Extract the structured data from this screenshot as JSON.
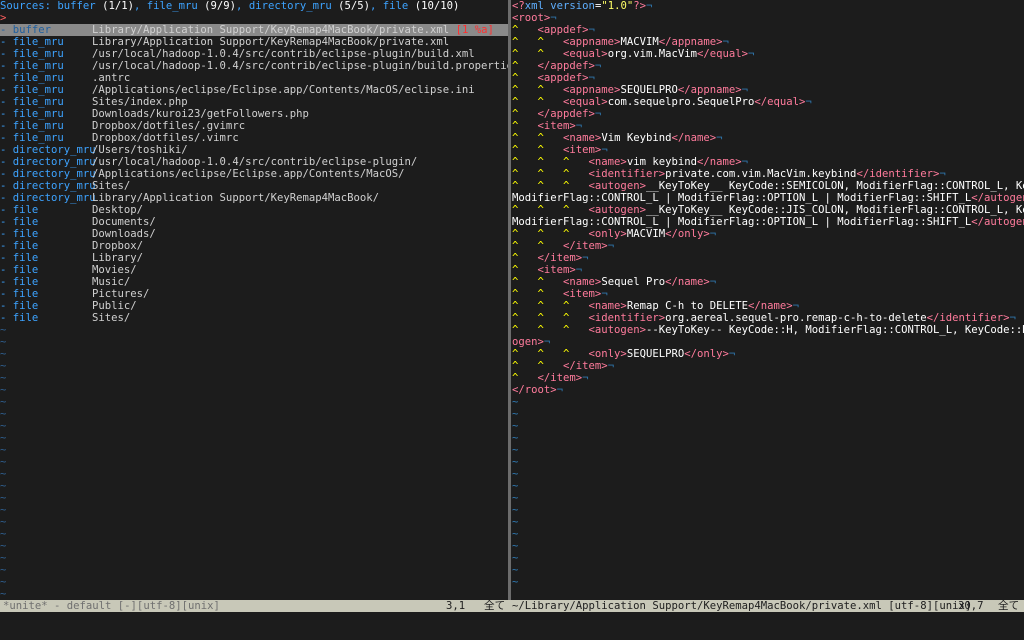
{
  "left": {
    "header": {
      "label": "Sources: ",
      "segments": [
        {
          "name": "buffer",
          "count": "(1/1)",
          "sep": ", "
        },
        {
          "name": "file_mru",
          "count": "(9/9)",
          "sep": ", "
        },
        {
          "name": "directory_mru",
          "count": "(5/5)",
          "sep": ", "
        },
        {
          "name": "file",
          "count": "(10/10)",
          "sep": ""
        }
      ]
    },
    "prompt": ">",
    "candidates": [
      {
        "kind": "- buffer",
        "path": "Library/Application Support/KeyRemap4MacBook/private.xml",
        "info": "[1 %a]",
        "selected": true
      },
      {
        "kind": "- file_mru",
        "path": "Library/Application Support/KeyRemap4MacBook/private.xml"
      },
      {
        "kind": "- file_mru",
        "path": "/usr/local/hadoop-1.0.4/src/contrib/eclipse-plugin/build.xml"
      },
      {
        "kind": "- file_mru",
        "path": "/usr/local/hadoop-1.0.4/src/contrib/eclipse-plugin/build.properties"
      },
      {
        "kind": "- file_mru",
        "path": ".antrc"
      },
      {
        "kind": "- file_mru",
        "path": "/Applications/eclipse/Eclipse.app/Contents/MacOS/eclipse.ini"
      },
      {
        "kind": "- file_mru",
        "path": "Sites/index.php"
      },
      {
        "kind": "- file_mru",
        "path": "Downloads/kuroi23/getFollowers.php"
      },
      {
        "kind": "- file_mru",
        "path": "Dropbox/dotfiles/.gvimrc"
      },
      {
        "kind": "- file_mru",
        "path": "Dropbox/dotfiles/.vimrc"
      },
      {
        "kind": "- directory_mru",
        "path": "/Users/toshiki/"
      },
      {
        "kind": "- directory_mru",
        "path": "/usr/local/hadoop-1.0.4/src/contrib/eclipse-plugin/"
      },
      {
        "kind": "- directory_mru",
        "path": "/Applications/eclipse/Eclipse.app/Contents/MacOS/"
      },
      {
        "kind": "- directory_mru",
        "path": "Sites/"
      },
      {
        "kind": "- directory_mru",
        "path": "Library/Application Support/KeyRemap4MacBook/"
      },
      {
        "kind": "- file",
        "path": "Desktop/"
      },
      {
        "kind": "- file",
        "path": "Documents/"
      },
      {
        "kind": "- file",
        "path": "Downloads/"
      },
      {
        "kind": "- file",
        "path": "Dropbox/"
      },
      {
        "kind": "- file",
        "path": "Library/"
      },
      {
        "kind": "- file",
        "path": "Movies/"
      },
      {
        "kind": "- file",
        "path": "Music/"
      },
      {
        "kind": "- file",
        "path": "Pictures/"
      },
      {
        "kind": "- file",
        "path": "Public/"
      },
      {
        "kind": "- file",
        "path": "Sites/"
      }
    ],
    "tilde": "~",
    "tilde_count": 23
  },
  "right": {
    "lines": [
      [
        {
          "c": "pi",
          "t": "<?"
        },
        {
          "c": "attr",
          "t": "xml version"
        },
        {
          "c": "tagtxt",
          "t": "="
        },
        {
          "c": "str",
          "t": "\"1.0\""
        },
        {
          "c": "pi",
          "t": "?>"
        },
        {
          "c": "tilde",
          "t": "¬"
        }
      ],
      [
        {
          "c": "tag",
          "t": "<root>"
        },
        {
          "c": "tilde",
          "t": "¬"
        }
      ],
      [
        {
          "c": "caret",
          "t": "^   "
        },
        {
          "c": "tag",
          "t": "<appdef>"
        },
        {
          "c": "tilde",
          "t": "¬"
        }
      ],
      [
        {
          "c": "caret",
          "t": "^   ^   "
        },
        {
          "c": "tag",
          "t": "<appname>"
        },
        {
          "c": "tagtxt",
          "t": "MACVIM"
        },
        {
          "c": "tag",
          "t": "</appname>"
        },
        {
          "c": "tilde",
          "t": "¬"
        }
      ],
      [
        {
          "c": "caret",
          "t": "^   ^   "
        },
        {
          "c": "tag",
          "t": "<equal>"
        },
        {
          "c": "tagtxt",
          "t": "org.vim.MacVim"
        },
        {
          "c": "tag",
          "t": "</equal>"
        },
        {
          "c": "tilde",
          "t": "¬"
        }
      ],
      [
        {
          "c": "caret",
          "t": "^   "
        },
        {
          "c": "tag",
          "t": "</appdef>"
        },
        {
          "c": "tilde",
          "t": "¬"
        }
      ],
      [
        {
          "c": "caret",
          "t": "^   "
        },
        {
          "c": "tag",
          "t": "<appdef>"
        },
        {
          "c": "tilde",
          "t": "¬"
        }
      ],
      [
        {
          "c": "caret",
          "t": "^   ^   "
        },
        {
          "c": "tag",
          "t": "<appname>"
        },
        {
          "c": "tagtxt",
          "t": "SEQUELPRO"
        },
        {
          "c": "tag",
          "t": "</appname>"
        },
        {
          "c": "tilde",
          "t": "¬"
        }
      ],
      [
        {
          "c": "caret",
          "t": "^   ^   "
        },
        {
          "c": "tag",
          "t": "<equal>"
        },
        {
          "c": "tagtxt",
          "t": "com.sequelpro.SequelPro"
        },
        {
          "c": "tag",
          "t": "</equal>"
        },
        {
          "c": "tilde",
          "t": "¬"
        }
      ],
      [
        {
          "c": "caret",
          "t": "^   "
        },
        {
          "c": "tag",
          "t": "</appdef>"
        },
        {
          "c": "tilde",
          "t": "¬"
        }
      ],
      [
        {
          "c": "caret",
          "t": "^   "
        },
        {
          "c": "tag",
          "t": "<item>"
        },
        {
          "c": "tilde",
          "t": "¬"
        }
      ],
      [
        {
          "c": "caret",
          "t": "^   ^   "
        },
        {
          "c": "tag",
          "t": "<name>"
        },
        {
          "c": "tagtxt",
          "t": "Vim Keybind"
        },
        {
          "c": "tag",
          "t": "</name>"
        },
        {
          "c": "tilde",
          "t": "¬"
        }
      ],
      [
        {
          "c": "caret",
          "t": "^   ^   "
        },
        {
          "c": "tag",
          "t": "<item>"
        },
        {
          "c": "tilde",
          "t": "¬"
        }
      ],
      [
        {
          "c": "caret",
          "t": "^   ^   ^   "
        },
        {
          "c": "tag",
          "t": "<name>"
        },
        {
          "c": "tagtxt",
          "t": "vim keybind"
        },
        {
          "c": "tag",
          "t": "</name>"
        },
        {
          "c": "tilde",
          "t": "¬"
        }
      ],
      [
        {
          "c": "caret",
          "t": "^   ^   ^   "
        },
        {
          "c": "tag",
          "t": "<identifier>"
        },
        {
          "c": "tagtxt",
          "t": "private.com.vim.MacVim.keybind"
        },
        {
          "c": "tag",
          "t": "</identifier>"
        },
        {
          "c": "tilde",
          "t": "¬"
        }
      ],
      [
        {
          "c": "caret",
          "t": "^   ^   ^   "
        },
        {
          "c": "tag",
          "t": "<autogen>"
        },
        {
          "c": "tagtxt",
          "t": "__KeyToKey__ KeyCode::SEMICOLON, ModifierFlag::CONTROL_L, KeyCode::A,"
        }
      ],
      [
        {
          "c": "tagtxt",
          "t": "ModifierFlag::CONTROL_L | ModifierFlag::OPTION_L | ModifierFlag::SHIFT_L"
        },
        {
          "c": "tag",
          "t": "</autogen>"
        },
        {
          "c": "tilde",
          "t": "¬"
        }
      ],
      [
        {
          "c": "caret",
          "t": "^   ^   ^   "
        },
        {
          "c": "tag",
          "t": "<autogen>"
        },
        {
          "c": "tagtxt",
          "t": "__KeyToKey__ KeyCode::JIS_COLON, ModifierFlag::CONTROL_L, KeyCode::B,"
        }
      ],
      [
        {
          "c": "tagtxt",
          "t": "ModifierFlag::CONTROL_L | ModifierFlag::OPTION_L | ModifierFlag::SHIFT_L"
        },
        {
          "c": "tag",
          "t": "</autogen>"
        },
        {
          "c": "tilde",
          "t": "¬"
        }
      ],
      [
        {
          "c": "caret",
          "t": "^   ^   ^   "
        },
        {
          "c": "tag",
          "t": "<only>"
        },
        {
          "c": "tagtxt",
          "t": "MACVIM"
        },
        {
          "c": "tag",
          "t": "</only>"
        },
        {
          "c": "tilde",
          "t": "¬"
        }
      ],
      [
        {
          "c": "caret",
          "t": "^   ^   "
        },
        {
          "c": "tag",
          "t": "</item>"
        },
        {
          "c": "tilde",
          "t": "¬"
        }
      ],
      [
        {
          "c": "caret",
          "t": "^   "
        },
        {
          "c": "tag",
          "t": "</item>"
        },
        {
          "c": "tilde",
          "t": "¬"
        }
      ],
      [
        {
          "c": "caret",
          "t": "^   "
        },
        {
          "c": "tag",
          "t": "<item>"
        },
        {
          "c": "tilde",
          "t": "¬"
        }
      ],
      [
        {
          "c": "caret",
          "t": "^   ^   "
        },
        {
          "c": "tag",
          "t": "<name>"
        },
        {
          "c": "tagtxt",
          "t": "Sequel Pro"
        },
        {
          "c": "tag",
          "t": "</name>"
        },
        {
          "c": "tilde",
          "t": "¬"
        }
      ],
      [
        {
          "c": "caret",
          "t": "^   ^   "
        },
        {
          "c": "tag",
          "t": "<item>"
        },
        {
          "c": "tilde",
          "t": "¬"
        }
      ],
      [
        {
          "c": "caret",
          "t": "^   ^   ^   "
        },
        {
          "c": "tag",
          "t": "<name>"
        },
        {
          "c": "tagtxt",
          "t": "Remap C-h to DELETE"
        },
        {
          "c": "tag",
          "t": "</name>"
        },
        {
          "c": "tilde",
          "t": "¬"
        }
      ],
      [
        {
          "c": "caret",
          "t": "^   ^   ^   "
        },
        {
          "c": "tag",
          "t": "<identifier>"
        },
        {
          "c": "tagtxt",
          "t": "org.aereal.sequel-pro.remap-c-h-to-delete"
        },
        {
          "c": "tag",
          "t": "</identifier>"
        },
        {
          "c": "tilde",
          "t": "¬"
        }
      ],
      [
        {
          "c": "caret",
          "t": "^   ^   ^   "
        },
        {
          "c": "tag",
          "t": "<autogen>"
        },
        {
          "c": "tagtxt",
          "t": "--KeyToKey-- KeyCode::H, ModifierFlag::CONTROL_L, KeyCode::DELETE"
        },
        {
          "c": "tag",
          "t": "</aut"
        }
      ],
      [
        {
          "c": "tag",
          "t": "ogen>"
        },
        {
          "c": "tilde",
          "t": "¬"
        }
      ],
      [
        {
          "c": "caret",
          "t": "^   ^   ^   "
        },
        {
          "c": "tag",
          "t": "<only>"
        },
        {
          "c": "tagtxt",
          "t": "SEQUELPRO"
        },
        {
          "c": "tag",
          "t": "</only>"
        },
        {
          "c": "tilde",
          "t": "¬"
        }
      ],
      [
        {
          "c": "caret",
          "t": "^   ^   "
        },
        {
          "c": "tag",
          "t": "</item>"
        },
        {
          "c": "tilde",
          "t": "¬"
        }
      ],
      [
        {
          "c": "caret",
          "t": "^   "
        },
        {
          "c": "tag",
          "t": "</item>"
        },
        {
          "c": "tilde",
          "t": "¬"
        }
      ],
      [
        {
          "c": "tag",
          "t": "</root>"
        },
        {
          "c": "tilde",
          "t": "¬"
        }
      ]
    ],
    "tilde": "~",
    "tilde_count": 16
  },
  "status": {
    "left_name": "*unite* - default [-][utf-8][unix]",
    "left_pos": "3,1",
    "left_pct": "全て",
    "right_name": "~/Library/Application Support/KeyRemap4MacBook/private.xml [utf-8][unix]",
    "right_pos": "30,7",
    "right_pct": "全て"
  },
  "colors": {
    "background": "#1c1c1c",
    "unite_kind": "#3da3ff",
    "xml_tag": "#ff7b9c",
    "indent_caret": "#ffff00",
    "statusline": "#c8c8b8"
  }
}
